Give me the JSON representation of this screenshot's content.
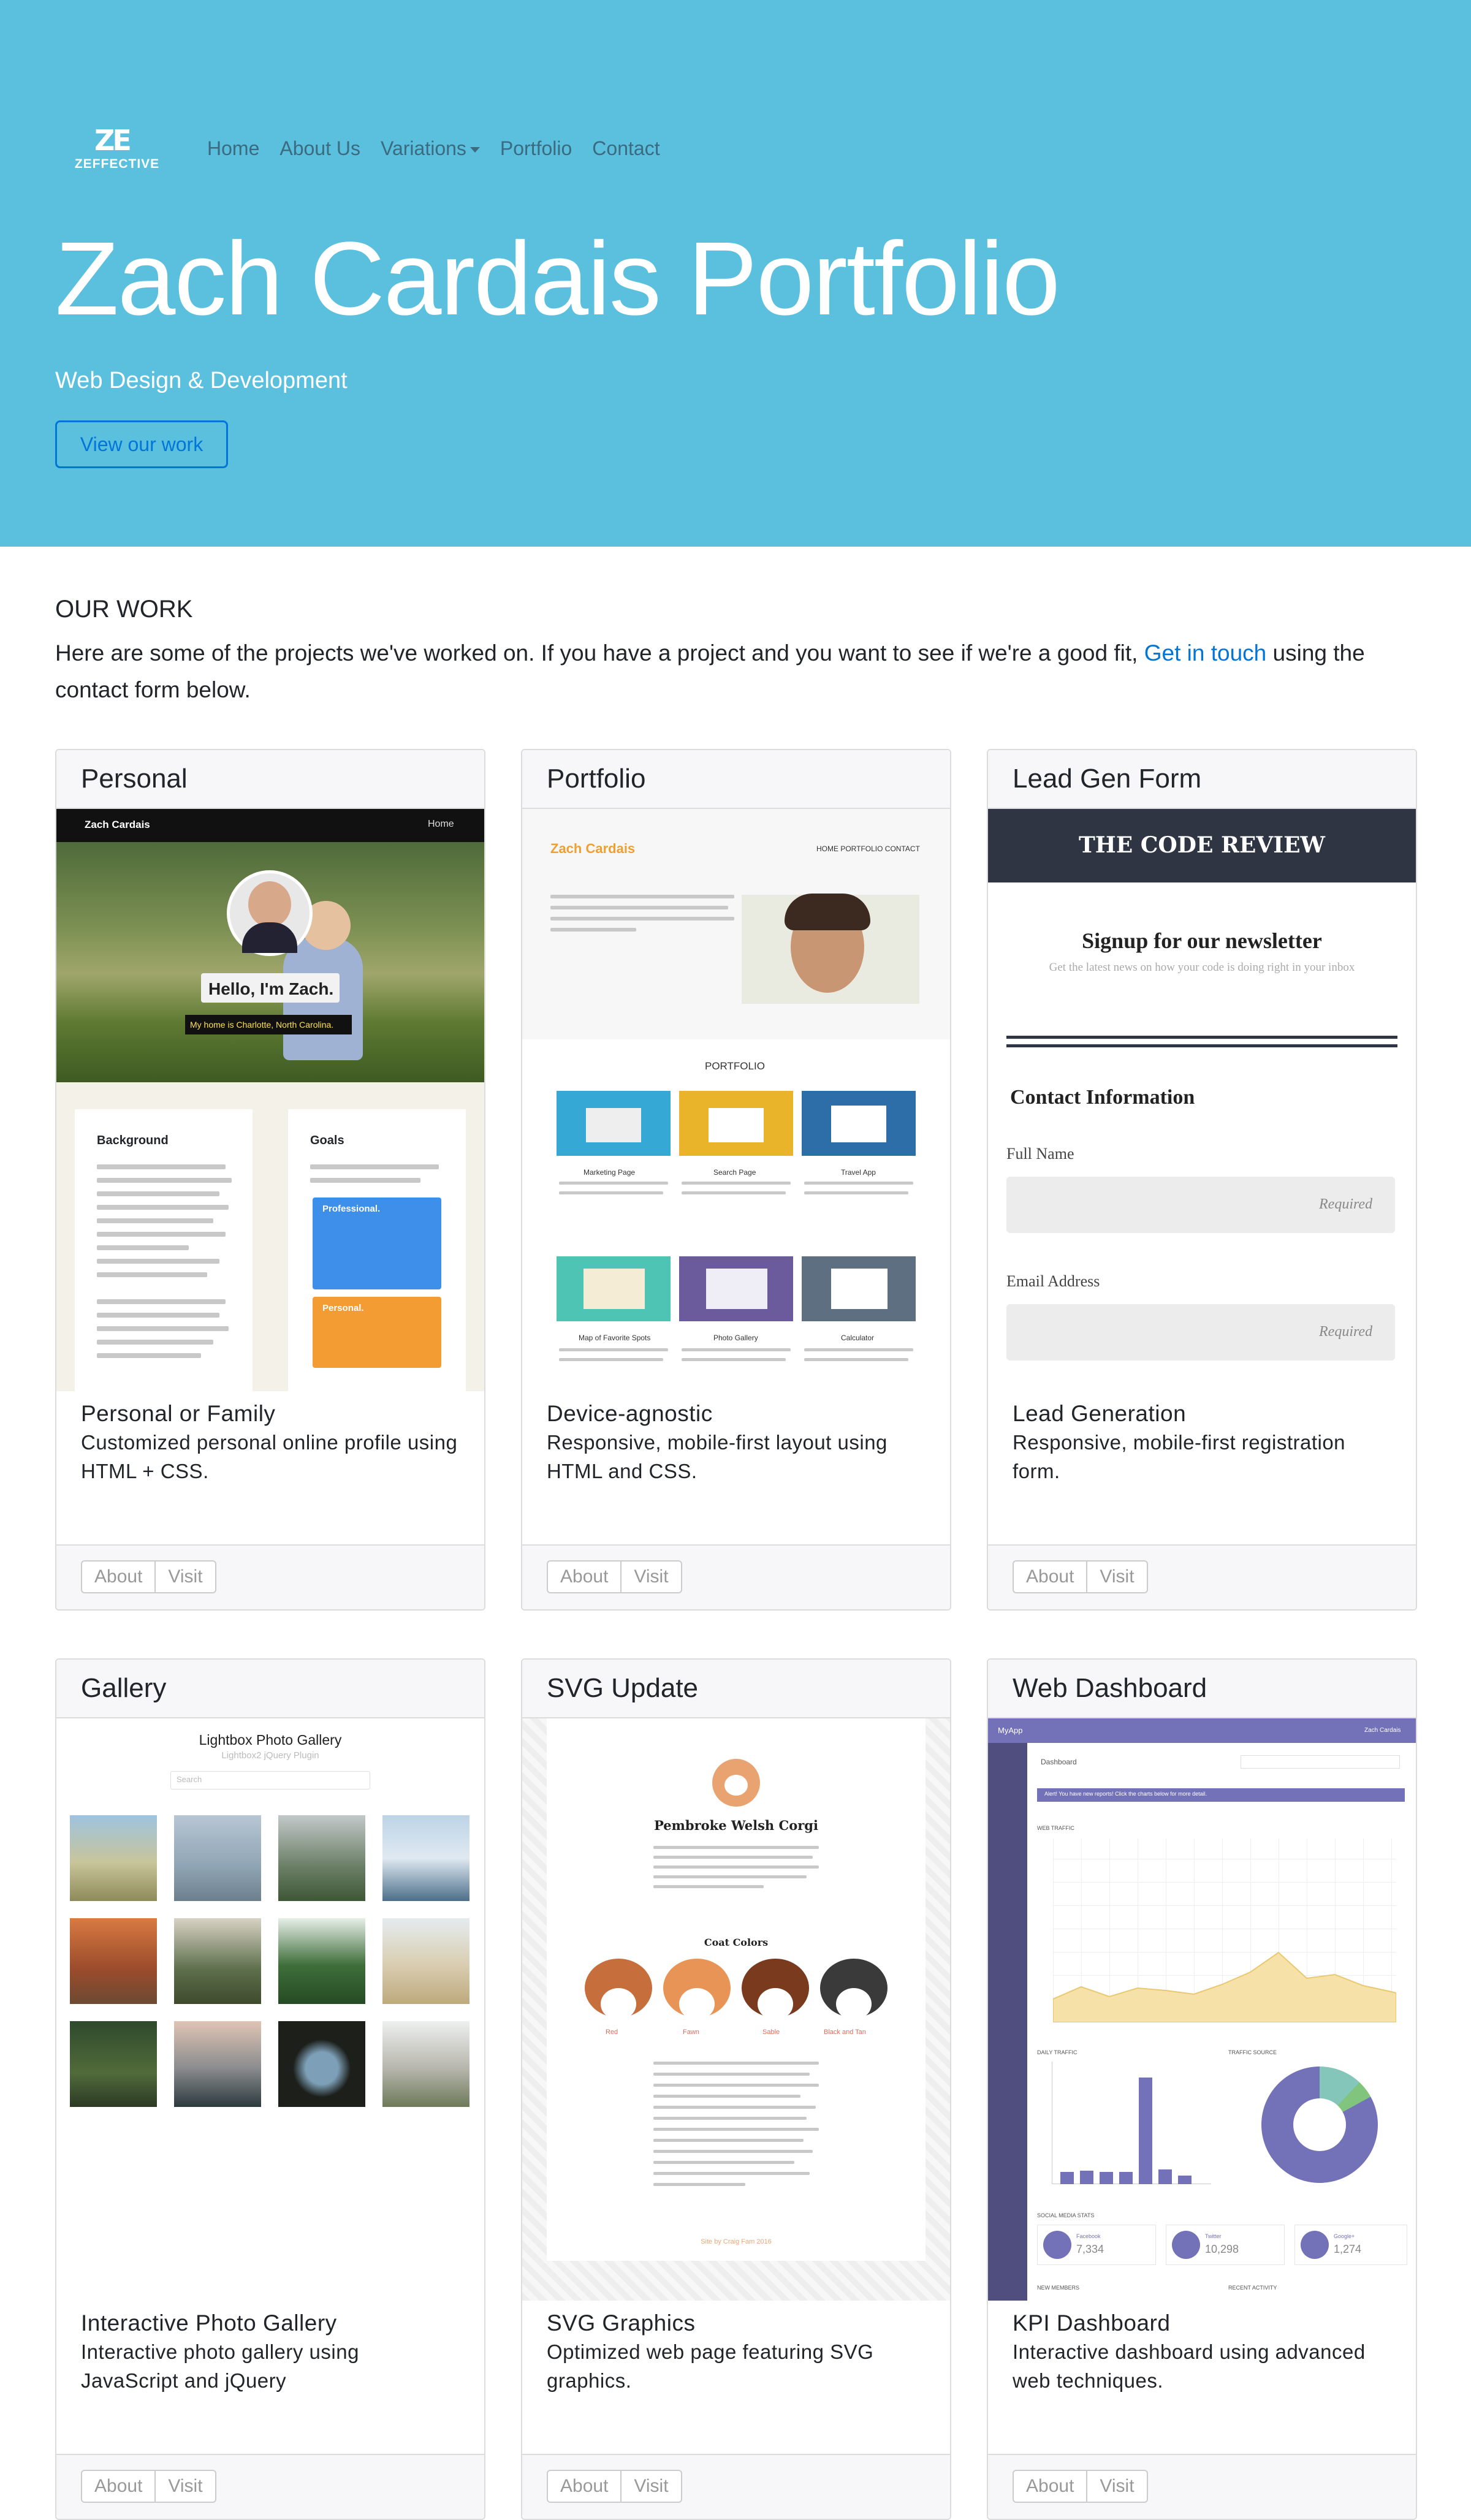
{
  "brand": {
    "mark": "ZE",
    "name": "ZEFFECTIVE"
  },
  "nav": [
    "Home",
    "About Us",
    "Variations",
    "Portfolio",
    "Contact"
  ],
  "hero": {
    "title": "Zach Cardais Portfolio",
    "subtitle": "Web Design & Development",
    "button": "View our work"
  },
  "work": {
    "heading": "OUR WORK",
    "intro_before": "Here are some of the projects we've worked on. If you have a project and you want to see if we're a good fit,",
    "intro_link": "Get in touch",
    "intro_after": "using the contact form below."
  },
  "cards": [
    {
      "header": "Personal",
      "title": "Personal or Family",
      "text": "Customized personal online profile using HTML + CSS.",
      "about": "About",
      "visit": "Visit"
    },
    {
      "header": "Portfolio",
      "title": "Device-agnostic",
      "text": "Responsive, mobile-first layout using HTML and CSS.",
      "about": "About",
      "visit": "Visit"
    },
    {
      "header": "Lead Gen Form",
      "title": "Lead Generation",
      "text": "Responsive, mobile-first registration form.",
      "about": "About",
      "visit": "Visit"
    },
    {
      "header": "Gallery",
      "title": "Interactive Photo Gallery",
      "text": "Interactive photo gallery using JavaScript and jQuery",
      "about": "About",
      "visit": "Visit"
    },
    {
      "header": "SVG Update",
      "title": "SVG Graphics",
      "text": "Optimized web page featuring SVG graphics.",
      "about": "About",
      "visit": "Visit"
    },
    {
      "header": "Web Dashboard",
      "title": "KPI Dashboard",
      "text": "Interactive dashboard using advanced web techniques.",
      "about": "About",
      "visit": "Visit"
    }
  ],
  "thumbs": {
    "personal": {
      "brand": "Zach Cardais",
      "nav": "Home",
      "hello": "Hello, I'm Zach.",
      "home": "My home is Charlotte, North Carolina.",
      "bg_title": "Background",
      "goals_title": "Goals",
      "pro": "Professional.",
      "personal": "Personal."
    },
    "portfolio": {
      "brand": "Zach Cardais",
      "nav": "HOME  PORTFOLIO  CONTACT",
      "section": "PORTFOLIO",
      "items": [
        "Marketing Page",
        "Search Page",
        "Travel App",
        "Map of Favorite Spots",
        "Photo Gallery",
        "Calculator"
      ]
    },
    "leadgen": {
      "banner": "THE CODE REVIEW",
      "signup": "Signup for our newsletter",
      "signup_sub": "Get the latest news on how your code is doing right in your inbox",
      "contact": "Contact Information",
      "full_name": "Full Name",
      "email": "Email Address",
      "required": "Required"
    },
    "gallery": {
      "title": "Lightbox Photo Gallery",
      "sub": "Lightbox2 jQuery Plugin",
      "search": "Search"
    },
    "svg": {
      "heading": "Pembroke Welsh Corgi",
      "coat": "Coat Colors",
      "colors": [
        "Red",
        "Fawn",
        "Sable",
        "Black and Tan"
      ],
      "credit": "Site by Craig Fam 2016"
    },
    "dashboard": {
      "app": "MyApp",
      "user": "Zach Cardais",
      "title": "Dashboard",
      "alert": "Alert! You have new reports! Click the charts below for more detail.",
      "traffic": "WEB TRAFFIC",
      "daily": "DAILY TRAFFIC",
      "source": "TRAFFIC SOURCE",
      "social": "SOCIAL MEDIA STATS",
      "new_members": "NEW MEMBERS",
      "recent": "RECENT ACTIVITY",
      "socials": [
        {
          "name": "Facebook",
          "count": "7,334"
        },
        {
          "name": "Twitter",
          "count": "10,298"
        },
        {
          "name": "Google+",
          "count": "1,274"
        }
      ]
    }
  },
  "colors": {
    "hero": "#5bc0de",
    "link": "#0275d8",
    "dash_sidebar": "#4f4e7e",
    "dash_accent": "#7371b8"
  }
}
